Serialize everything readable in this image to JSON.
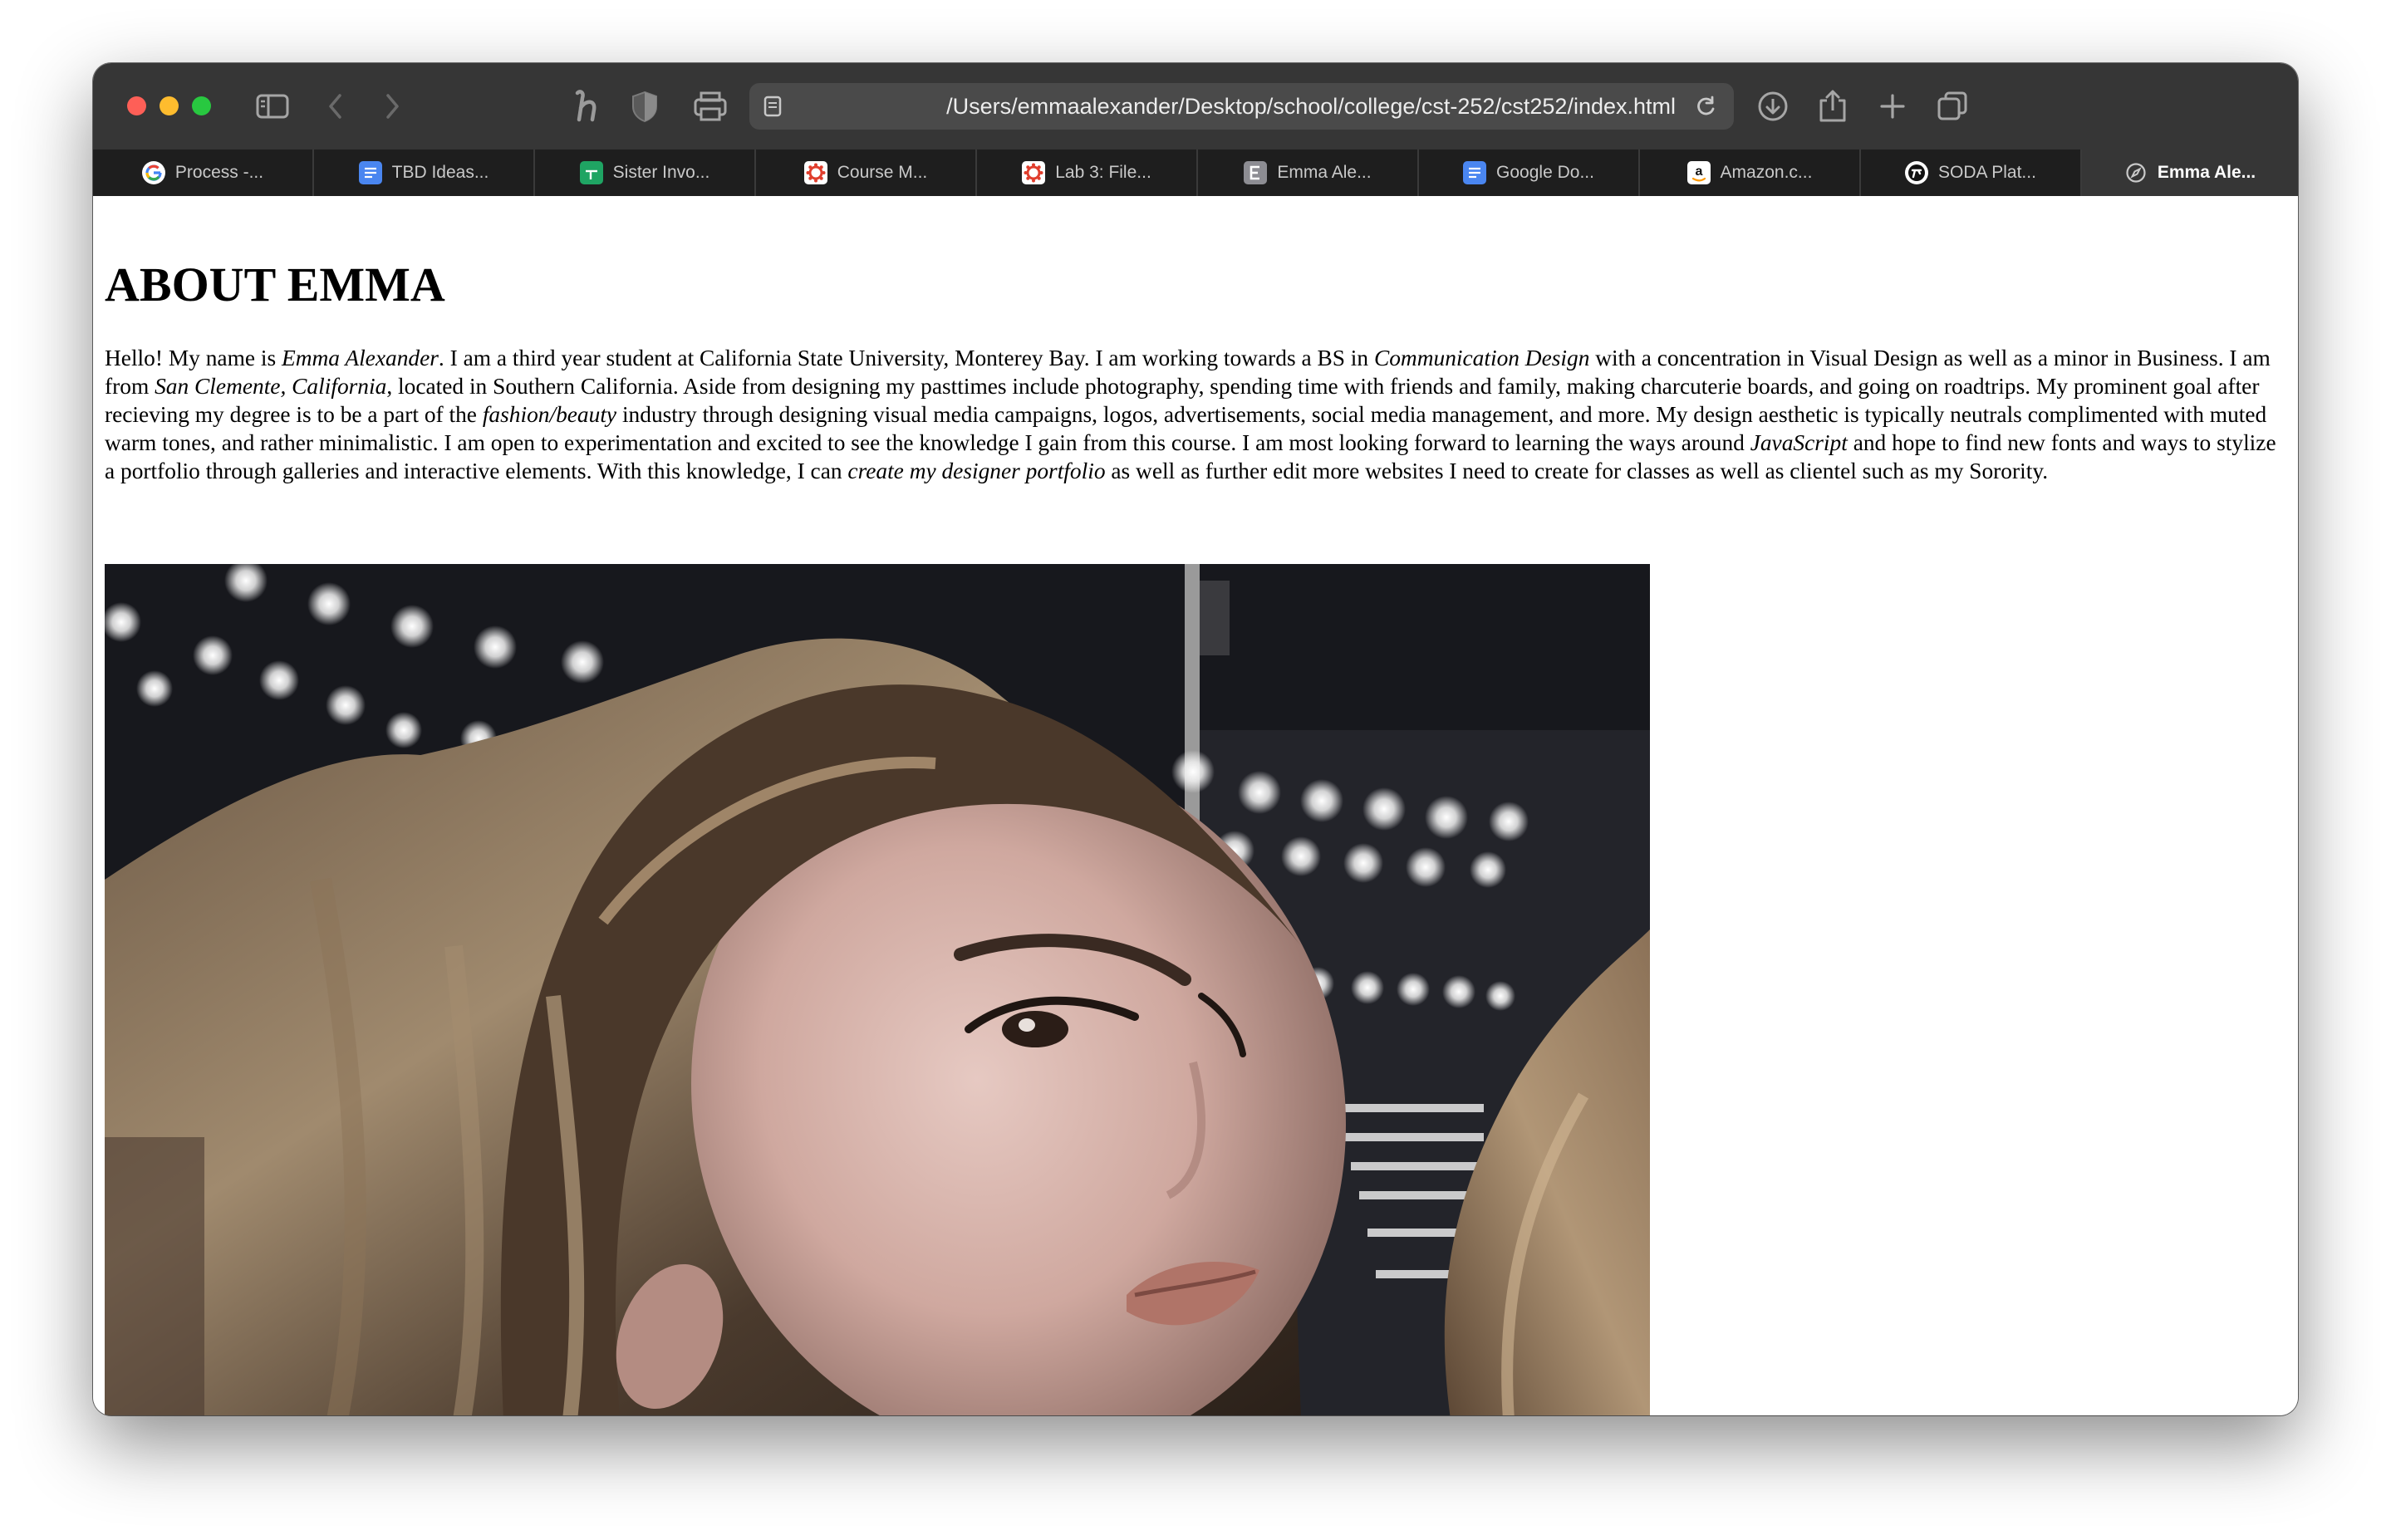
{
  "browser": {
    "url": "/Users/emmaalexander/Desktop/school/college/cst-252/cst252/index.html",
    "tabs": [
      {
        "label": "Process -...",
        "icon": "google-icon"
      },
      {
        "label": "TBD Ideas...",
        "icon": "google-docs-icon"
      },
      {
        "label": "Sister Invo...",
        "icon": "google-sheets-icon"
      },
      {
        "label": "Course M...",
        "icon": "canvas-icon"
      },
      {
        "label": "Lab 3: File...",
        "icon": "canvas-icon"
      },
      {
        "label": "Emma Ale...",
        "icon": "letter-e-icon"
      },
      {
        "label": "Google Do...",
        "icon": "google-docs-icon"
      },
      {
        "label": "Amazon.c...",
        "icon": "amazon-icon"
      },
      {
        "label": "SODA Plat...",
        "icon": "soda-icon"
      },
      {
        "label": "Emma Ale...",
        "icon": "compass-icon",
        "active": true
      }
    ],
    "colors": {
      "toolbar": "#363636",
      "tabbar": "#1e1e1e",
      "address_bar": "#4a4a4a",
      "traffic_red": "#fe5f57",
      "traffic_yellow": "#febc2e",
      "traffic_green": "#28c840"
    }
  },
  "page": {
    "heading": "ABOUT EMMA",
    "bio": [
      {
        "text": "Hello! My name is "
      },
      {
        "text": "Emma Alexander",
        "italic": true
      },
      {
        "text": ". I am a third year student at California State University, Monterey Bay. I am working towards a BS in "
      },
      {
        "text": "Communication Design",
        "italic": true
      },
      {
        "text": " with a concentration in Visual Design as well as a minor in Business. I am from "
      },
      {
        "text": "San Clemente, California",
        "italic": true
      },
      {
        "text": ", located in Southern California. Aside from designing my pasttimes include photography, spending time with friends and family, making charcuterie boards, and going on roadtrips. My prominent goal after recieving my degree is to be a part of the "
      },
      {
        "text": "fashion/beauty",
        "italic": true
      },
      {
        "text": " industry through designing visual media campaigns, logos, advertisements, social media management, and more. My design aesthetic is typically neutrals complimented with muted warm tones, and rather minimalistic. I am open to experimentation and excited to see the knowledge I gain from this course. I am most looking forward to learning the ways around "
      },
      {
        "text": "JavaScript",
        "italic": true
      },
      {
        "text": " and hope to find new fonts and ways to stylize a portfolio through galleries and interactive elements. With this knowledge, I can "
      },
      {
        "text": "create my designer portfolio",
        "italic": true
      },
      {
        "text": " as well as further edit more websites I need to create for classes as well as clientel such as my Sorority."
      }
    ],
    "photo": {
      "icon": "portrait-photo"
    }
  }
}
